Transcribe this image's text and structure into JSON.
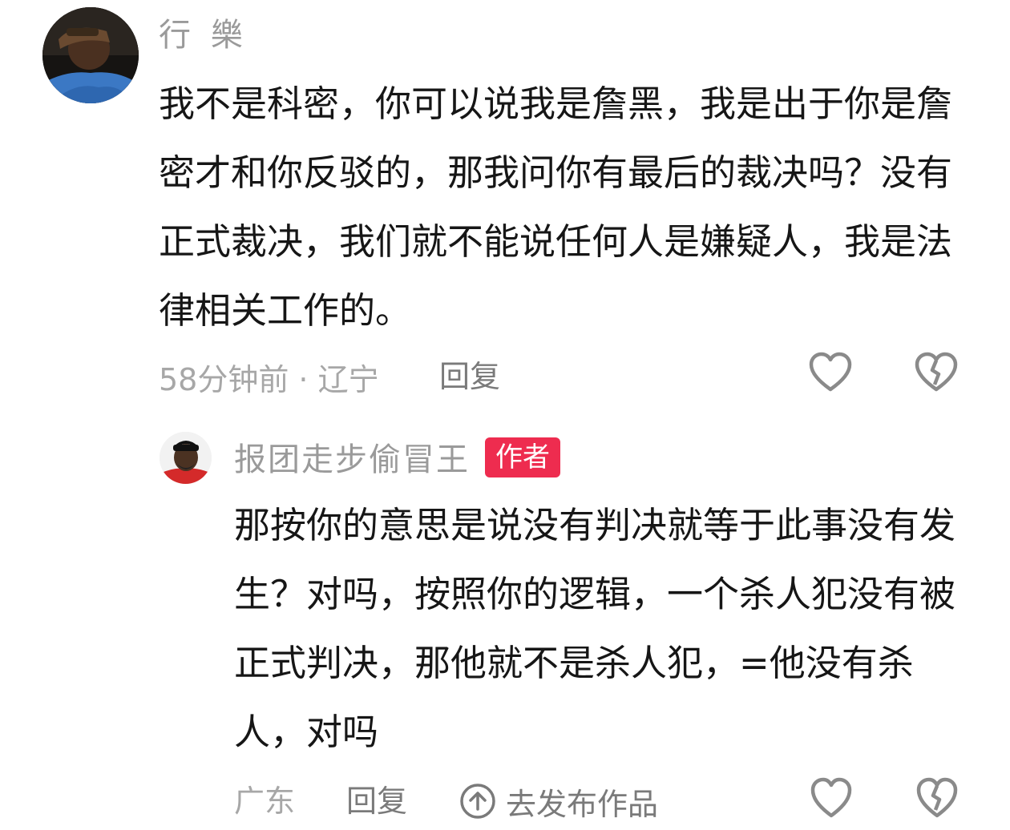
{
  "comment": {
    "username": "行 樂",
    "text": "我不是科密，你可以说我是詹黑，我是出于你是詹密才和你反驳的，那我问你有最后的裁决吗？没有正式裁决，我们就不能说任何人是嫌疑人，我是法律相关工作的。",
    "time_location": "58分钟前 · 辽宁",
    "reply_label": "回复",
    "icons": {
      "like": "heart-outline-icon",
      "dislike": "broken-heart-icon"
    }
  },
  "reply": {
    "username": "报团走步偷冒王",
    "badge": "作者",
    "text": "那按你的意思是说没有判决就等于此事没有发生？对吗，按照你的逻辑，一个杀人犯没有被正式判决，那他就不是杀人犯，=他没有杀人，对吗",
    "location": "广东",
    "reply_label": "回复",
    "goto_works_label": "去发布作品",
    "icons": {
      "goto": "arrow-up-circle-icon",
      "like": "heart-outline-icon",
      "dislike": "broken-heart-icon"
    },
    "badge_color": "#ee2c4f"
  }
}
